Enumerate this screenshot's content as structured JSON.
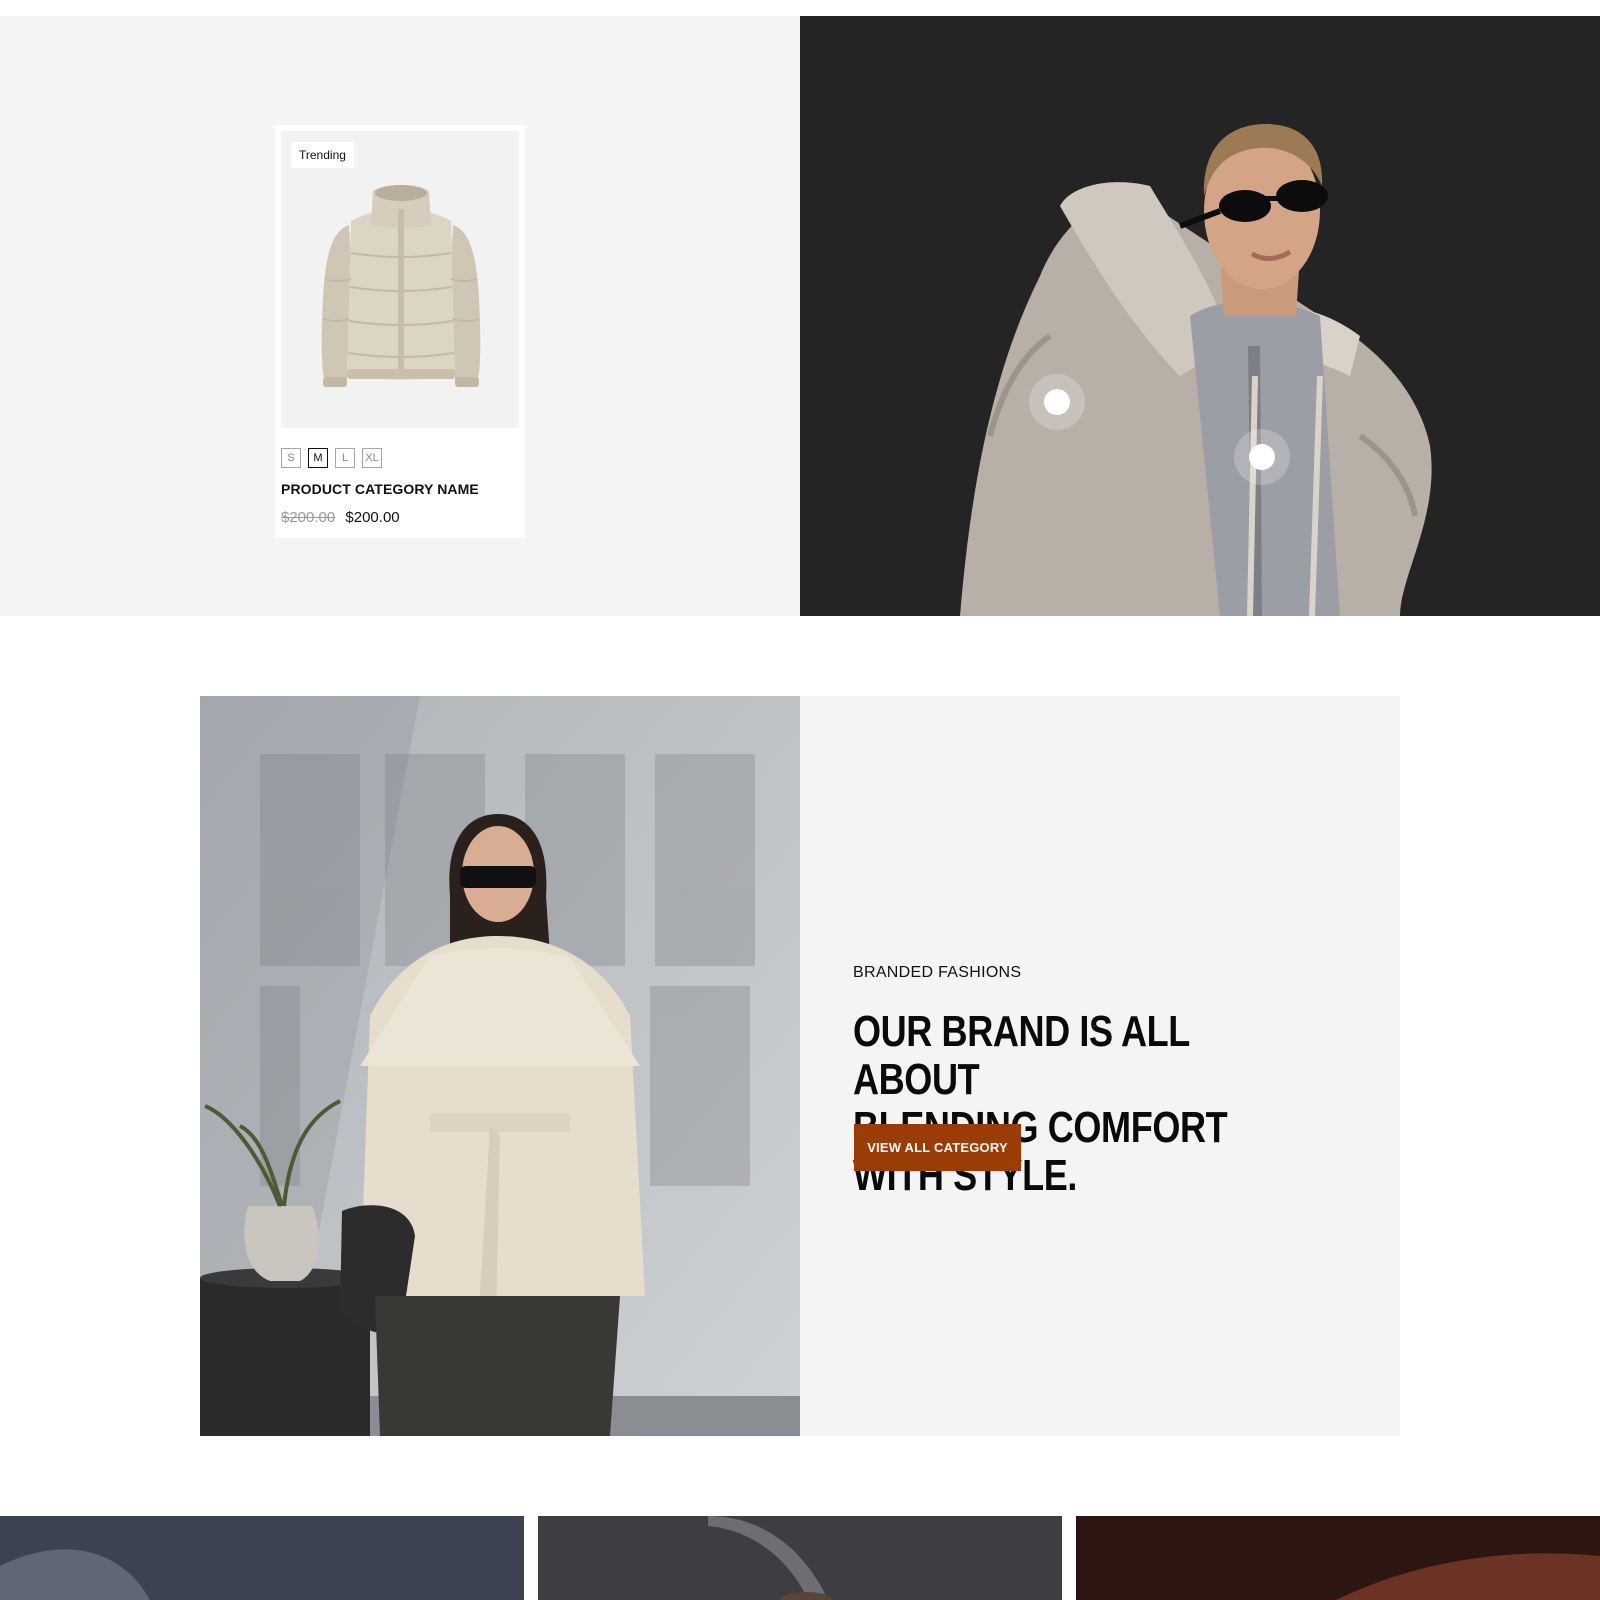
{
  "featured_product": {
    "badge": "Trending",
    "sizes": [
      "S",
      "M",
      "L",
      "XL"
    ],
    "selected_size": "M",
    "name": "PRODUCT CATEGORY NAME",
    "old_price": "$200.00",
    "price": "$200.00",
    "image_icon": "puffer-jacket-image"
  },
  "hero_image": {
    "icon": "model-puffer-jacket-photo",
    "hotspot_count": 2
  },
  "brand_section": {
    "eyebrow": "BRANDED FASHIONS",
    "headline_line1": "OUR BRAND IS ALL ABOUT",
    "headline_line2": "BLENDING COMFORT WITH STYLE.",
    "cta_label": "VIEW ALL CATEGORY",
    "image_icon": "model-cream-coat-photo",
    "accent_color": "#9a3c06"
  },
  "category_tiles": [
    {
      "color": "#3c4250"
    },
    {
      "color": "#3e3d42"
    },
    {
      "color": "#2d1611"
    }
  ]
}
